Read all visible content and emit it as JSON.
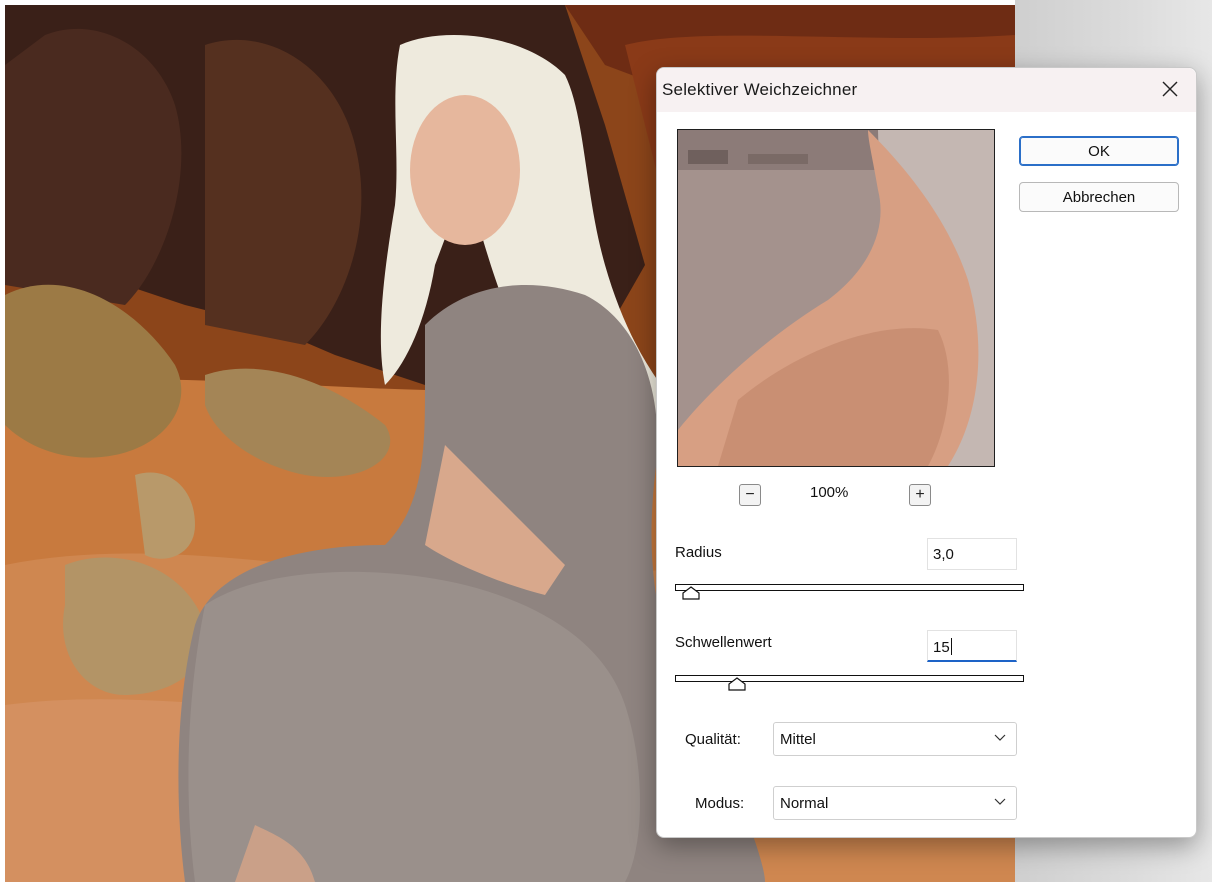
{
  "dialog": {
    "title": "Selektiver Weichzeichner",
    "close_icon": "close-icon",
    "ok_label": "OK",
    "cancel_label": "Abbrechen",
    "zoom_out_label": "−",
    "zoom_in_label": "+",
    "zoom_level": "100%",
    "radius": {
      "label": "Radius",
      "value": "3,0",
      "slider_fraction": 0.02
    },
    "threshold": {
      "label": "Schwellenwert",
      "value": "15",
      "slider_fraction": 0.16
    },
    "quality": {
      "label": "Qualität:",
      "value": "Mittel"
    },
    "mode": {
      "label": "Modus:",
      "value": "Normal"
    }
  },
  "colors": {
    "accent": "#1d63c7",
    "ok_border": "#2b6fc8"
  }
}
